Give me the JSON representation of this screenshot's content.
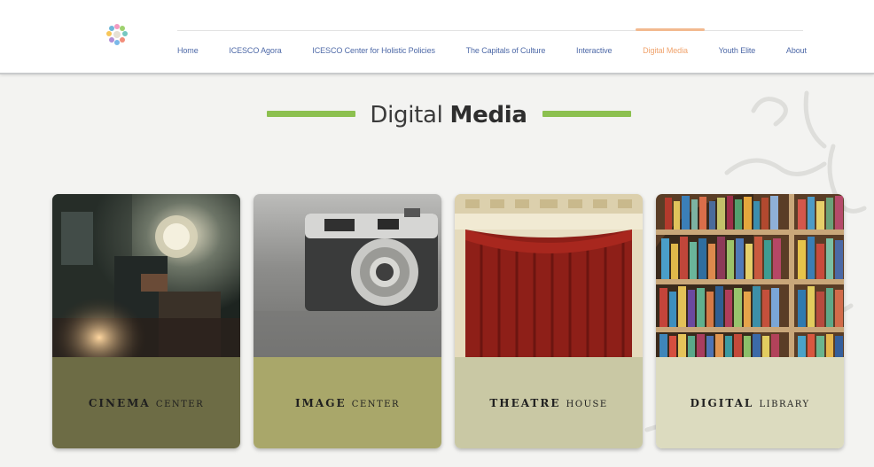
{
  "header": {
    "logo_icon": "icesco-logo-icon",
    "nav": [
      {
        "label": "Home",
        "active": false
      },
      {
        "label": "ICESCO Agora",
        "active": false
      },
      {
        "label": "ICESCO Center for Holistic Policies",
        "active": false
      },
      {
        "label": "The Capitals of Culture",
        "active": false
      },
      {
        "label": "Interactive",
        "active": false
      },
      {
        "label": "Digital Media",
        "active": true
      },
      {
        "label": "Youth Elite",
        "active": false
      },
      {
        "label": "About",
        "active": false
      }
    ]
  },
  "main": {
    "title_light": "Digital ",
    "title_bold": "Media"
  },
  "cards": [
    {
      "first": "Cinema",
      "second": "Center",
      "foot_color": "#6d6c45",
      "image": "film-projector-image"
    },
    {
      "first": "Image",
      "second": "Center",
      "foot_color": "#a9a76a",
      "image": "camera-image"
    },
    {
      "first": "Theatre",
      "second": "House",
      "foot_color": "#c9c8a4",
      "image": "theatre-curtain-image"
    },
    {
      "first": "Digital",
      "second": "Library",
      "foot_color": "#dcdbbf",
      "image": "bookshelf-image"
    }
  ],
  "colors": {
    "accent_green": "#8cc04f",
    "nav_link": "#4f6aa8",
    "nav_active": "#f0a46e"
  }
}
